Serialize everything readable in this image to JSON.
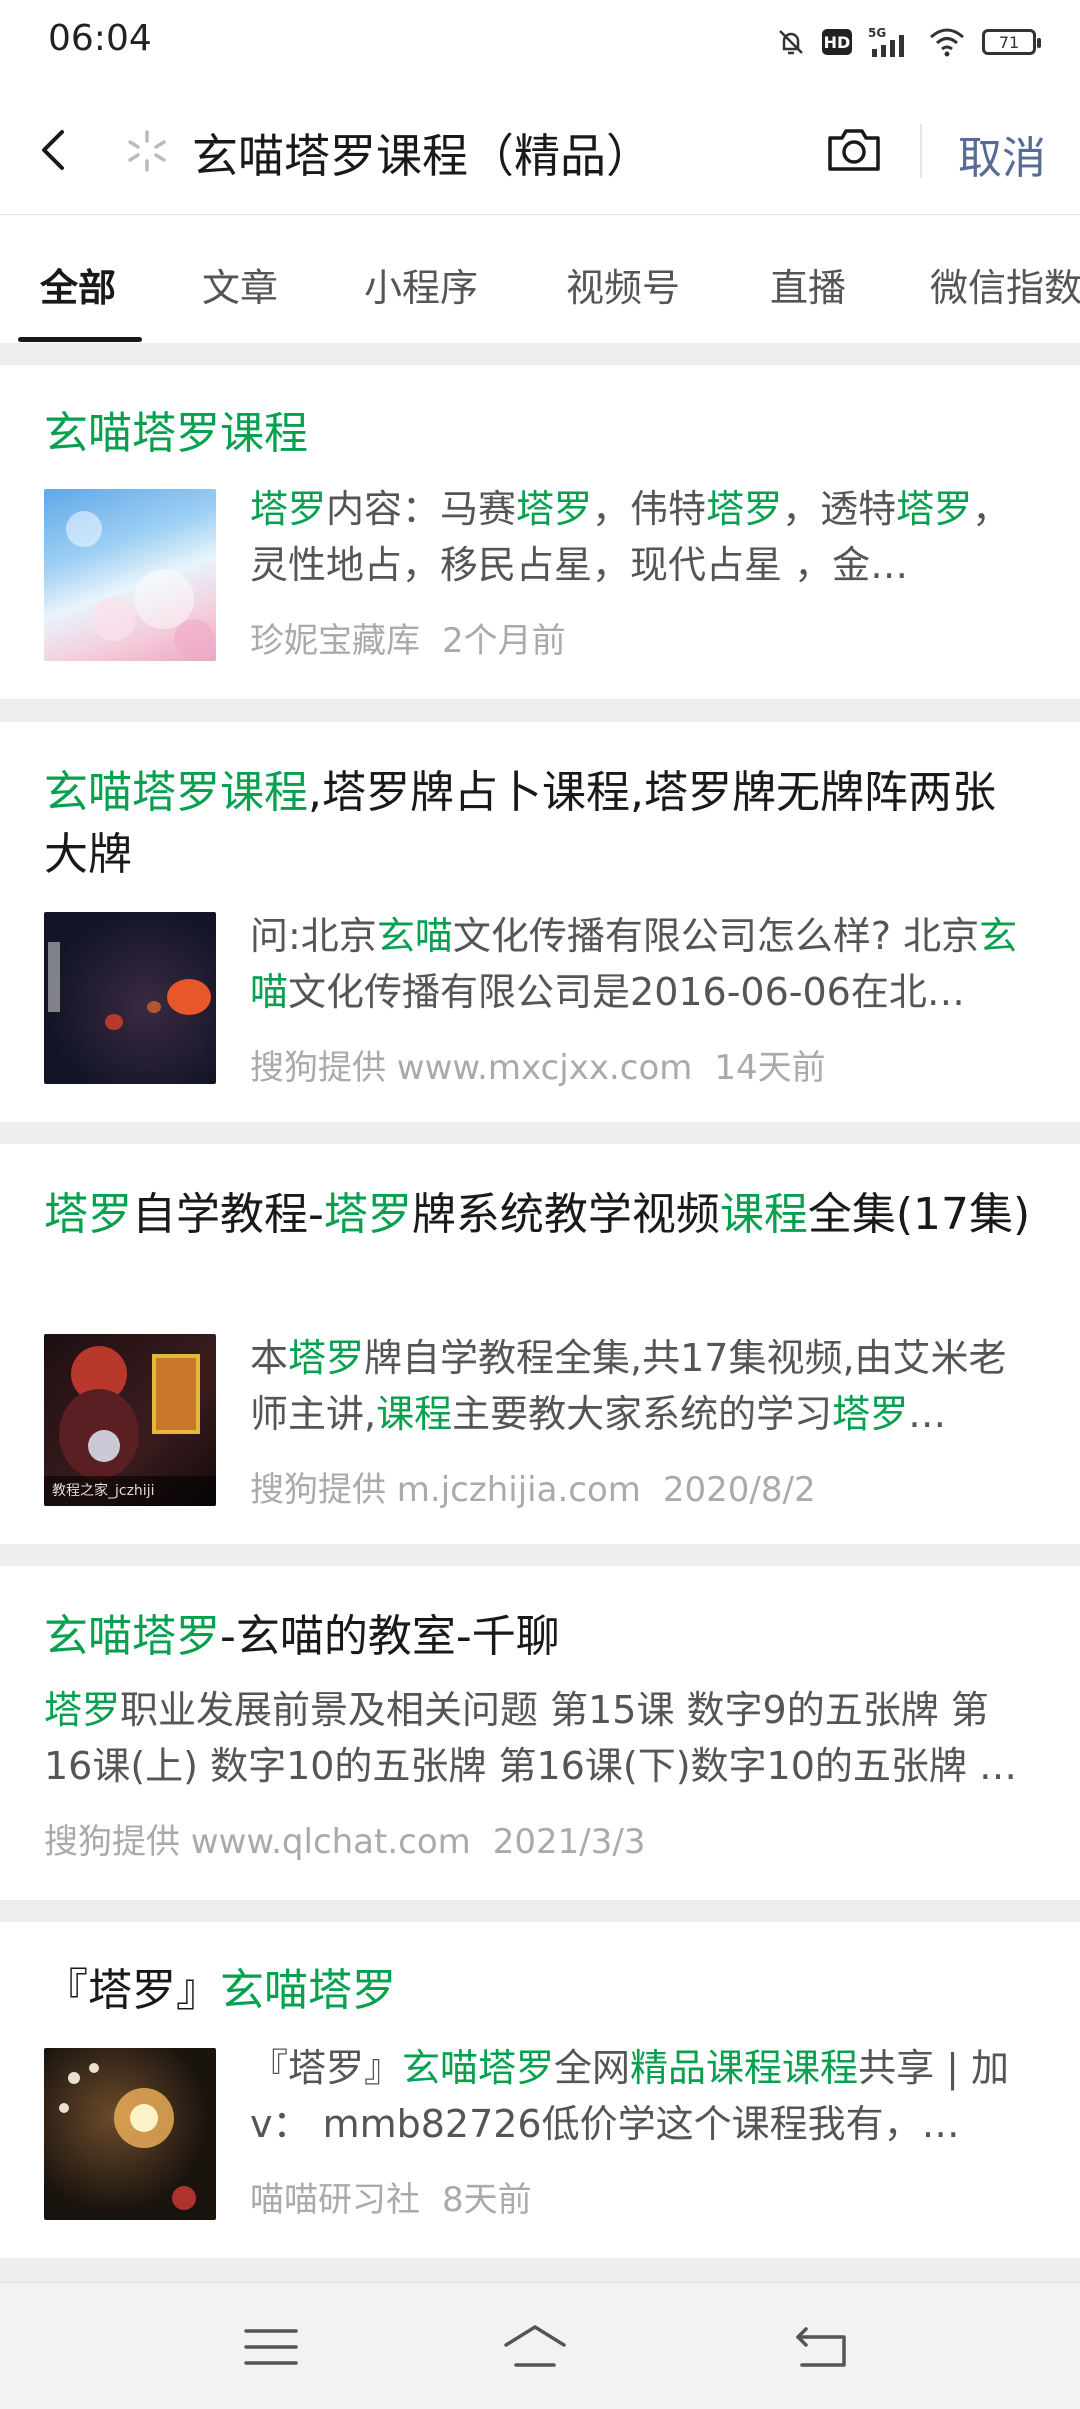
{
  "status": {
    "time": "06:04",
    "network": "5G",
    "battery": "71"
  },
  "search": {
    "query": "玄喵塔罗课程（精品）",
    "cancel_label": "取消"
  },
  "tabs": [
    {
      "label": "全部",
      "active": true
    },
    {
      "label": "文章"
    },
    {
      "label": "小程序"
    },
    {
      "label": "视频号"
    },
    {
      "label": "直播"
    },
    {
      "label": "微信指数"
    }
  ],
  "results": [
    {
      "title": [
        {
          "t": "玄喵塔罗课程",
          "h": true
        }
      ],
      "snippet": [
        {
          "t": "塔罗",
          "h": true
        },
        {
          "t": "内容：马赛"
        },
        {
          "t": "塔罗",
          "h": true
        },
        {
          "t": "，伟特"
        },
        {
          "t": "塔罗",
          "h": true
        },
        {
          "t": "，透特"
        },
        {
          "t": "塔罗",
          "h": true
        },
        {
          "t": "，灵性地占，移民占星，现代占星 ，金…"
        }
      ],
      "source": "珍妮宝藏库",
      "time": "2个月前"
    },
    {
      "title": [
        {
          "t": "玄喵塔罗课程",
          "h": true
        },
        {
          "t": ",塔罗牌占卜课程,塔罗牌无牌阵两张大牌"
        }
      ],
      "snippet": [
        {
          "t": "问:北京"
        },
        {
          "t": "玄喵",
          "h": true
        },
        {
          "t": "文化传播有限公司怎么样? 北京"
        },
        {
          "t": "玄喵",
          "h": true
        },
        {
          "t": "文化传播有限公司是2016-06-06在北…"
        }
      ],
      "source": "搜狗提供 www.mxcjxx.com",
      "time": "14天前"
    },
    {
      "title": [
        {
          "t": "塔罗",
          "h": true
        },
        {
          "t": "自学教程-"
        },
        {
          "t": "塔罗",
          "h": true
        },
        {
          "t": "牌系统教学视频"
        },
        {
          "t": "课程",
          "h": true
        },
        {
          "t": "全集(17集)"
        }
      ],
      "snippet": [
        {
          "t": "本"
        },
        {
          "t": "塔罗",
          "h": true
        },
        {
          "t": "牌自学教程全集,共17集视频,由艾米老师主讲,"
        },
        {
          "t": "课程",
          "h": true
        },
        {
          "t": "主要教大家系统的学习"
        },
        {
          "t": "塔罗",
          "h": true
        },
        {
          "t": "…"
        }
      ],
      "source": "搜狗提供 m.jczhijia.com",
      "time": "2020/8/2",
      "thumb_caption": "教程之家_jczhiji"
    },
    {
      "title": [
        {
          "t": "玄喵塔罗",
          "h": true
        },
        {
          "t": "-玄喵的教室-千聊"
        }
      ],
      "snippet": [
        {
          "t": "塔罗",
          "h": true
        },
        {
          "t": "职业发展前景及相关问题 第15课 数字9的五张牌 第16课(上) 数字10的五张牌 第16课(下)数字10的五张牌 …"
        }
      ],
      "source": "搜狗提供 www.qlchat.com",
      "time": "2021/3/3"
    },
    {
      "title": [
        {
          "t": "『塔罗』"
        },
        {
          "t": "玄喵塔罗",
          "h": true
        }
      ],
      "snippet": [
        {
          "t": "『塔罗』"
        },
        {
          "t": "玄喵塔罗",
          "h": true
        },
        {
          "t": "全网"
        },
        {
          "t": "精品课程课程",
          "h": true
        },
        {
          "t": "共享 | 加v： mmb82726低价学这个课程我有，…"
        }
      ],
      "source": "喵喵研习社",
      "time": "8天前"
    }
  ]
}
